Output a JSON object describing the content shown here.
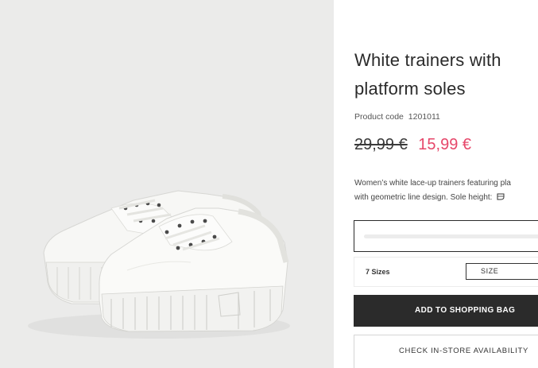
{
  "product": {
    "title": "White trainers with platform soles",
    "code_label": "Product code",
    "code_value": "1201011",
    "old_price": "29,99 €",
    "new_price": "15,99 €",
    "description_line1": "Women’s white lace-up trainers featuring pla",
    "description_line2": "with geometric line design. Sole height:"
  },
  "sizes": {
    "count_label": "7 Sizes",
    "select_label": "SIZE"
  },
  "actions": {
    "add_to_bag": "ADD TO SHOPPING BAG",
    "check_store": "CHECK IN-STORE AVAILABILITY"
  },
  "icons": {
    "sole_height": "sole-height-icon",
    "product_image": "white-platform-trainers-image"
  },
  "colors": {
    "sale_price": "#e6476a",
    "primary_button": "#2b2b2b",
    "photo_background": "#ebebea"
  }
}
